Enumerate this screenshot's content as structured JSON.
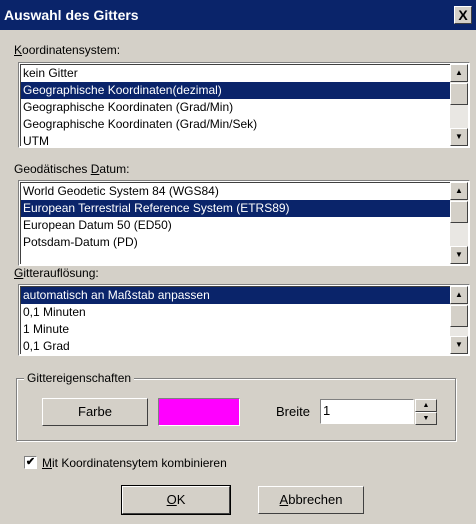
{
  "window": {
    "title": "Auswahl des Gitters",
    "close_glyph": "X"
  },
  "coord_system": {
    "label_mnemonic": "K",
    "label_rest": "oordinatensystem:",
    "items": [
      "kein Gitter",
      "Geographische Koordinaten(dezimal)",
      "Geographische Koordinaten (Grad/Min)",
      "Geographische Koordinaten (Grad/Min/Sek)",
      "UTM"
    ],
    "selected_index": 1
  },
  "datum": {
    "label_pre": "Geodätisches ",
    "label_mnemonic": "D",
    "label_rest": "atum:",
    "items": [
      "World Geodetic System 84 (WGS84)",
      "European Terrestrial Reference System (ETRS89)",
      "European Datum 50 (ED50)",
      "Potsdam-Datum (PD)"
    ],
    "selected_index": 1
  },
  "resolution": {
    "label_mnemonic": "G",
    "label_rest": "itterauflösung:",
    "items": [
      "automatisch an Maßstab anpassen",
      "0,1 Minuten",
      "1 Minute",
      "0,1 Grad"
    ],
    "selected_index": 0
  },
  "grid_props": {
    "title": "Gittereigenschaften",
    "color_button": "Farbe",
    "swatch_color": "#ff00ff",
    "width_label": "Breite",
    "width_value": "1"
  },
  "combine": {
    "checked_glyph": "✔",
    "label_mnemonic": "M",
    "label_rest": "it Koordinatensytem kombinieren"
  },
  "buttons": {
    "ok_mnemonic": "O",
    "ok_rest": "K",
    "cancel_mnemonic": "A",
    "cancel_rest": "bbrechen"
  },
  "icons": {
    "scroll_up": "▲",
    "scroll_down": "▼"
  },
  "colors": {
    "titlebar": "#0a246a",
    "selection": "#0a246a",
    "face": "#d4d0c8"
  }
}
